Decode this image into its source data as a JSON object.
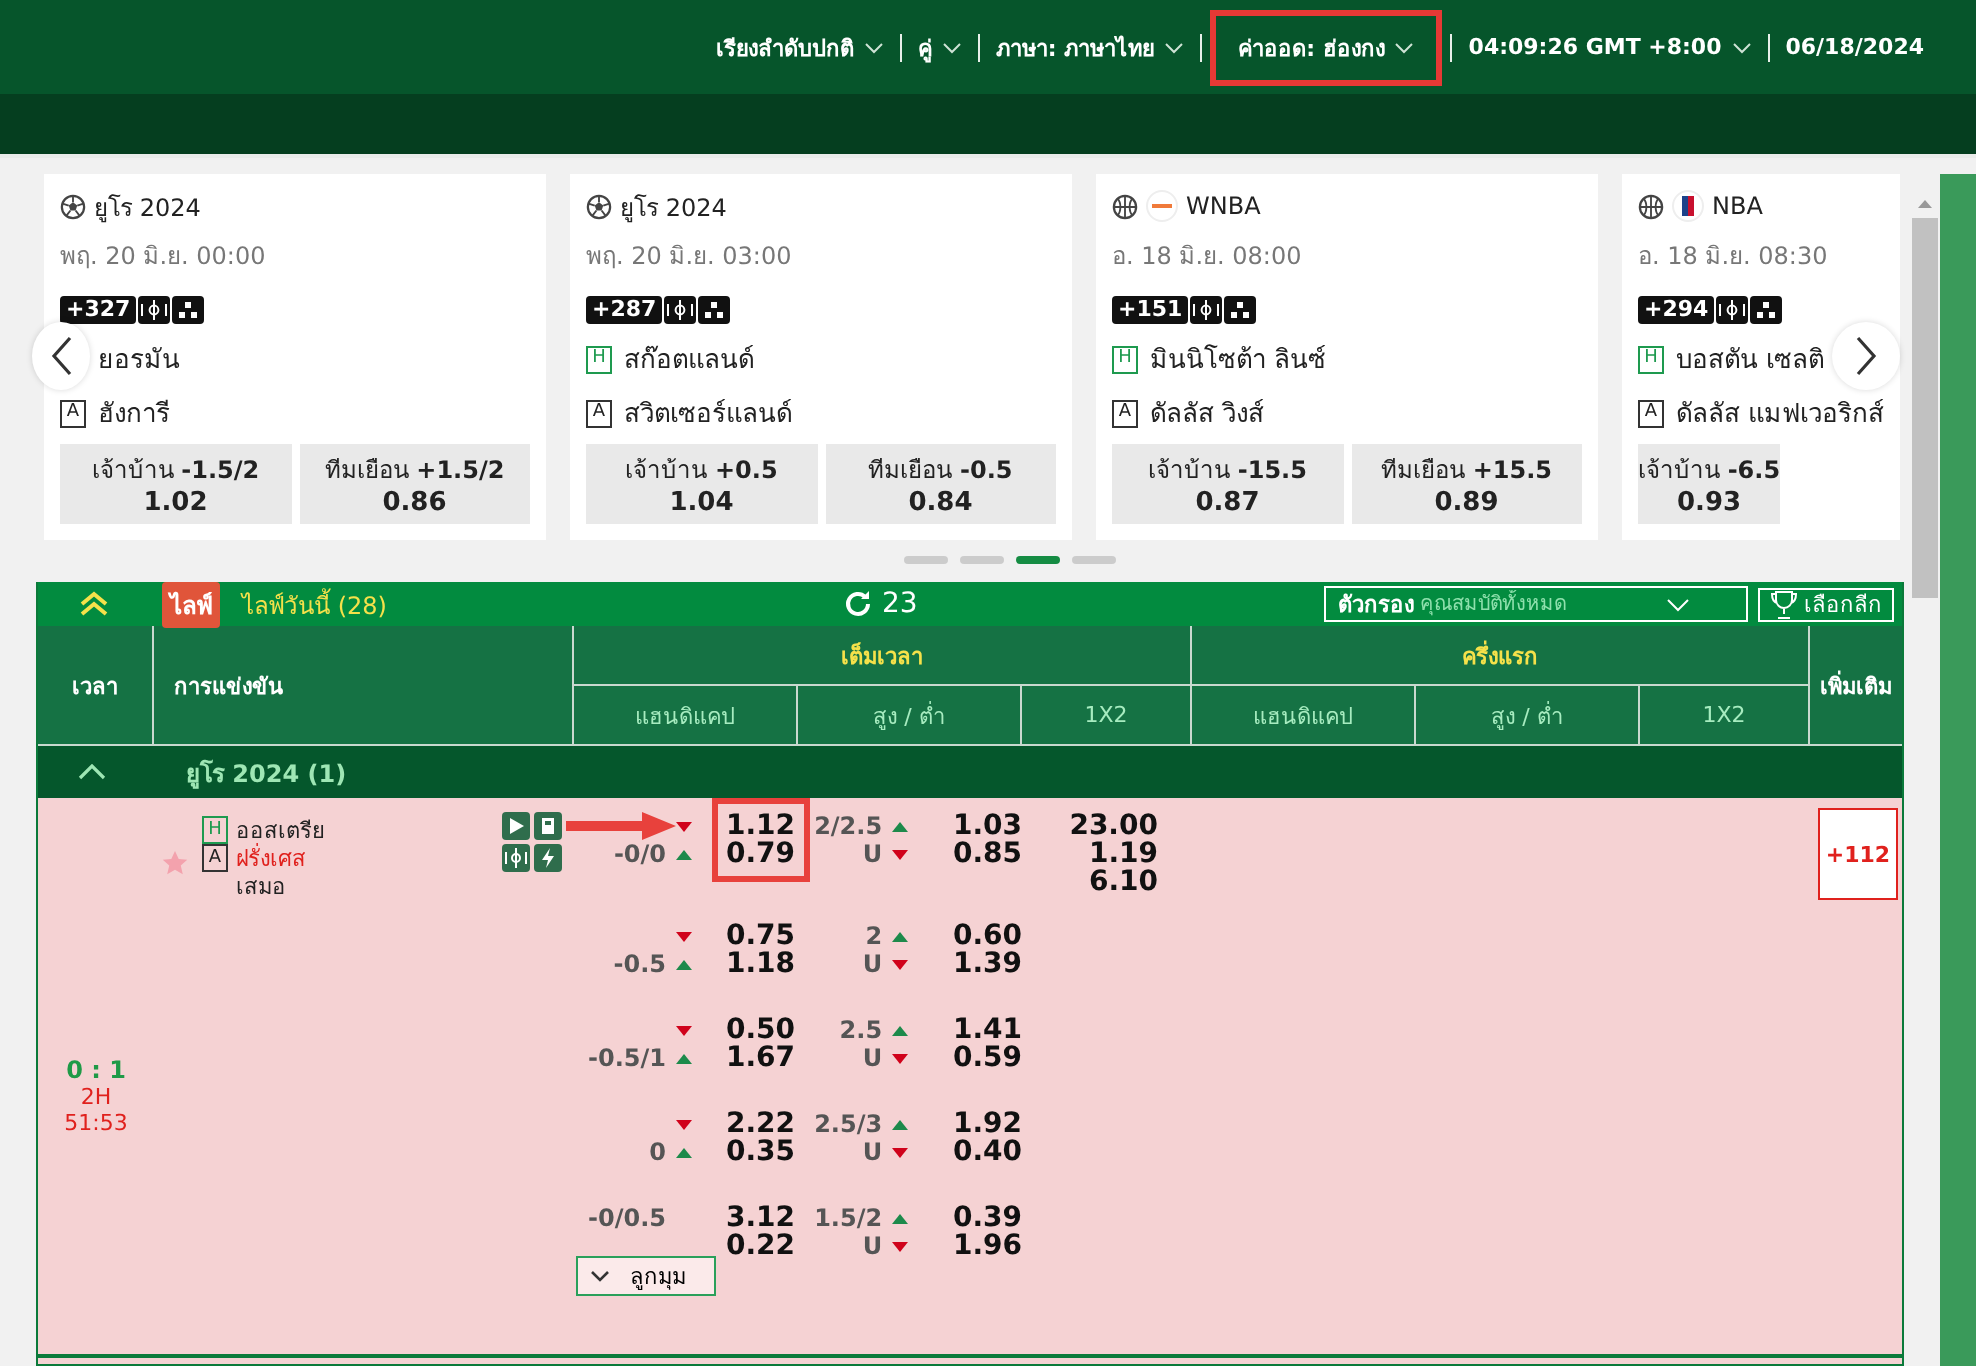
{
  "top_menu": [
    {
      "label": "เรียงลำดับปกติ",
      "dropdown": true,
      "highlighted": false
    },
    {
      "label": "คู่",
      "dropdown": true,
      "highlighted": false
    },
    {
      "label": "ภาษา: ภาษาไทย",
      "dropdown": true,
      "highlighted": false
    },
    {
      "label": "ค่าออด: ฮ่องกง",
      "dropdown": true,
      "highlighted": true
    },
    {
      "label": "04:09:26 GMT +8:00",
      "dropdown": true,
      "highlighted": false
    },
    {
      "label": "06/18/2024",
      "dropdown": false,
      "highlighted": false
    }
  ],
  "cards": [
    {
      "kind": "soccer",
      "league": "ยูโร 2024",
      "date": "พฤ. 20 มิ.ย. 00:00",
      "markets_count": "+327",
      "teams": [
        {
          "name": "ยอรมัน"
        },
        {
          "kind": "away",
          "badge": "A",
          "name": "ฮังการี"
        }
      ],
      "odds": [
        {
          "label": "เจ้าบ้าน",
          "line": "-1.5/2",
          "price": "1.02"
        },
        {
          "label": "ทีมเยือน",
          "line": "+1.5/2",
          "price": "0.86"
        }
      ]
    },
    {
      "kind": "soccer",
      "league": "ยูโร 2024",
      "date": "พฤ. 20 มิ.ย. 03:00",
      "markets_count": "+287",
      "teams": [
        {
          "kind": "home",
          "badge": "H",
          "name": "สก๊อตแลนด์"
        },
        {
          "kind": "away",
          "badge": "A",
          "name": "สวิตเซอร์แลนด์"
        }
      ],
      "odds": [
        {
          "label": "เจ้าบ้าน",
          "line": "+0.5",
          "price": "1.04"
        },
        {
          "label": "ทีมเยือน",
          "line": "-0.5",
          "price": "0.84"
        }
      ]
    },
    {
      "kind": "basketball",
      "logo": {
        "kind": "ring"
      },
      "league": "WNBA",
      "date": "อ. 18 มิ.ย. 08:00",
      "markets_count": "+151",
      "teams": [
        {
          "kind": "home",
          "badge": "H",
          "name": "มินนิโซต้า ลินซ์"
        },
        {
          "kind": "away",
          "badge": "A",
          "name": "ดัลลัส วิงส์"
        }
      ],
      "odds": [
        {
          "label": "เจ้าบ้าน",
          "line": "-15.5",
          "price": "0.87"
        },
        {
          "label": "ทีมเยือน",
          "line": "+15.5",
          "price": "0.89"
        }
      ]
    },
    {
      "kind": "basketball",
      "logo": {
        "kind": "shield"
      },
      "league": "NBA",
      "date": "อ. 18 มิ.ย. 08:30",
      "markets_count": "+294",
      "teams": [
        {
          "kind": "home",
          "badge": "H",
          "name": "บอสตัน เซลติ"
        },
        {
          "kind": "away",
          "badge": "A",
          "name": "ดัลลัส แมฟเวอริกส์"
        }
      ],
      "odds": [
        {
          "label": "เจ้าบ้าน",
          "line": "-6.5",
          "price": "0.93"
        }
      ]
    }
  ],
  "carousel_dots": [
    {
      "selected": false
    },
    {
      "selected": false
    },
    {
      "selected": true
    },
    {
      "selected": false
    }
  ],
  "live_bar": {
    "badge": "ไลฟ์",
    "title": "ไลฟ์วันนี้ (28)",
    "refresh_count": "23",
    "filter_label": "ตัวกรอง",
    "filter_placeholder": "คุณสมบัติทั้งหมด",
    "league_button": "เลือกลีก"
  },
  "columns": {
    "time": "เวลา",
    "competition": "การแข่งขัน",
    "groups": [
      {
        "title": "เต็มเวลา",
        "subs": [
          "แฮนดิแคป",
          "สูง / ต่ำ",
          "1X2"
        ]
      },
      {
        "title": "ครึ่งแรก",
        "subs": [
          "แฮนดิแคป",
          "สูง / ต่ำ",
          "1X2"
        ]
      }
    ],
    "more": "เพิ่มเติม"
  },
  "league": {
    "name": "ยูโร 2024 (1)",
    "expanded": true
  },
  "match": {
    "score": "0 : 1",
    "period": "2H",
    "clock": "51:53",
    "teams": [
      {
        "badge": "H",
        "name": "ออสเตรีย",
        "favored": false
      },
      {
        "badge": "A",
        "name": "ฝรั่งเศส",
        "favored": true
      }
    ],
    "draw": "เสมอ",
    "markets": [
      {
        "home": {
          "odds": "1.12",
          "kind": "falling"
        },
        "away": {
          "line": "-0/0",
          "odds": "0.79",
          "kind": "rising"
        },
        "ou_line": "2/2.5",
        "over": {
          "odds": "1.03",
          "kind": "rising"
        },
        "under_label": "U",
        "under": {
          "odds": "0.85",
          "kind": "falling"
        },
        "one_x_two": [
          "23.00",
          "1.19",
          "6.10"
        ],
        "highlighted": true
      },
      {
        "home": {
          "odds": "0.75",
          "kind": "falling"
        },
        "away": {
          "line": "-0.5",
          "odds": "1.18",
          "kind": "rising"
        },
        "ou_line": "2",
        "over": {
          "odds": "0.60",
          "kind": "rising"
        },
        "under_label": "U",
        "under": {
          "odds": "1.39",
          "kind": "falling"
        },
        "highlighted": false
      },
      {
        "home": {
          "odds": "0.50",
          "kind": "falling"
        },
        "away": {
          "line": "-0.5/1",
          "odds": "1.67",
          "kind": "rising"
        },
        "ou_line": "2.5",
        "over": {
          "odds": "1.41",
          "kind": "rising"
        },
        "under_label": "U",
        "under": {
          "odds": "0.59",
          "kind": "falling"
        },
        "highlighted": false
      },
      {
        "home": {
          "odds": "2.22",
          "kind": "falling"
        },
        "away": {
          "line": "0",
          "odds": "0.35",
          "kind": "rising"
        },
        "ou_line": "2.5/3",
        "over": {
          "odds": "1.92",
          "kind": "rising"
        },
        "under_label": "U",
        "under": {
          "odds": "0.40",
          "kind": "falling"
        },
        "highlighted": false
      },
      {
        "home": {
          "line": "-0/0.5",
          "odds": "3.12",
          "kind": "steady"
        },
        "away": {
          "odds": "0.22",
          "kind": "steady"
        },
        "ou_line": "1.5/2",
        "over": {
          "odds": "0.39",
          "kind": "rising"
        },
        "under_label": "U",
        "under": {
          "odds": "1.96",
          "kind": "falling"
        },
        "highlighted": false
      }
    ],
    "more": "+112",
    "corner_button": "ลูกมุม"
  }
}
